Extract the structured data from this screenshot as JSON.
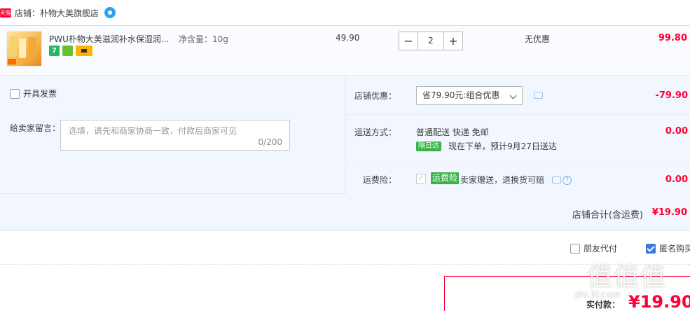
{
  "shop": {
    "badge": "天猫",
    "label": "店铺：",
    "name": "朴物大美旗舰店"
  },
  "item": {
    "title": "PWU朴物大美滋润补水保湿润...",
    "spec": "净含量：10g",
    "unit_price": "49.90",
    "quantity": "2",
    "discount": "无优惠",
    "subtotal": "99.80",
    "icons": [
      "seven-day-return-icon",
      "shield-icon",
      "credit-card-icon"
    ],
    "icon_seven_text": "7"
  },
  "options": {
    "invoice_label": "开具发票",
    "note_label": "给卖家留言：",
    "note_placeholder": "选填，请先和商家协商一致，付款后商家可见",
    "note_count": "0/200",
    "shop_discount_label": "店铺优惠：",
    "shop_discount_selected": "省79.90元:组合优惠",
    "shop_discount_value": "-79.90",
    "shipping_label": "运送方式：",
    "shipping_text": "普通配送 快递 免邮",
    "shipping_tag": "隔日达",
    "shipping_eta": "现在下单，预计9月27日送达",
    "shipping_value": "0.00",
    "insurance_label": "运费险：",
    "insurance_tag": "运费险",
    "insurance_text": "卖家赠送，退换货可赔",
    "insurance_value": "0.00"
  },
  "shop_total": {
    "label": "店铺合计(含运费)",
    "value": "¥19.90"
  },
  "bottom": {
    "friend_pay_label": "朋友代付",
    "anonymous_label": "匿名购买",
    "anonymous_checked": true
  },
  "pay": {
    "label": "实付款：",
    "amount": "¥19.90"
  },
  "watermark": {
    "text": "值值值",
    "small_text": "zhi.lif.com"
  },
  "colors": {
    "price_red": "#ff0036",
    "panel_blue": "#f2f7ff",
    "tag_green": "#3cb34a",
    "tmall_red": "#ff0036"
  }
}
